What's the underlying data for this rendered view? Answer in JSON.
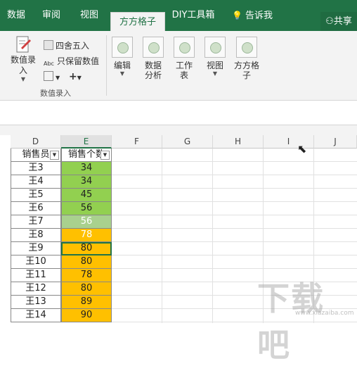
{
  "tabs": [
    {
      "label": "数据"
    },
    {
      "label": "审阅"
    },
    {
      "label": "视图"
    },
    {
      "label": "方方格子"
    },
    {
      "label": "DIY工具箱"
    },
    {
      "label": "告诉我"
    }
  ],
  "share_label": "共享",
  "ribbon": {
    "input_button": "数值录入",
    "round_button": "四舍五入",
    "keep_values_button": "只保留数值",
    "group_label": "数值录入",
    "edit_button": "编辑",
    "analysis_button": "数据分析",
    "worksheet_button": "工作表",
    "view_button": "视图",
    "fangfang_button": "方方格子"
  },
  "grid": {
    "columns": [
      "D",
      "E",
      "F",
      "G",
      "H",
      "I",
      "J"
    ],
    "header_row": [
      "销售员",
      "销售个数"
    ],
    "rows": [
      {
        "name": "王3",
        "value": "34"
      },
      {
        "name": "王4",
        "value": "34"
      },
      {
        "name": "王5",
        "value": "45"
      },
      {
        "name": "王6",
        "value": "56"
      },
      {
        "name": "王7",
        "value": "56"
      },
      {
        "name": "王8",
        "value": "78"
      },
      {
        "name": "王9",
        "value": "80"
      },
      {
        "name": "王10",
        "value": "80"
      },
      {
        "name": "王11",
        "value": "78"
      },
      {
        "name": "王12",
        "value": "80"
      },
      {
        "name": "王13",
        "value": "89"
      },
      {
        "name": "王14",
        "value": "90"
      }
    ]
  },
  "colors": {
    "green_fill": "#92d050",
    "light_green_fill": "#a9d18e",
    "yellow_fill": "#ffc000",
    "excel_green": "#217346"
  },
  "watermark": "下载吧",
  "watermark_url": "www.xiazaiba.com"
}
